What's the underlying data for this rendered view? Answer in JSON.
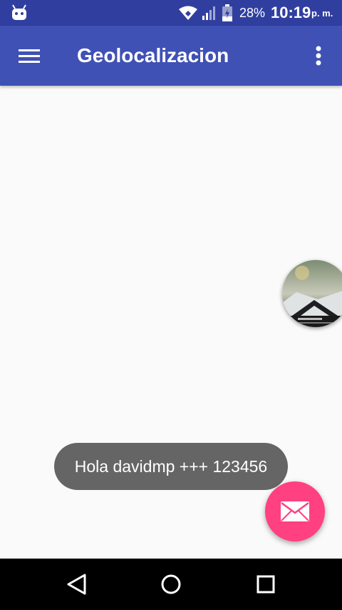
{
  "status_bar": {
    "icons": [
      "android-icon",
      "wifi-icon",
      "signal-icon",
      "battery-icon"
    ],
    "battery": "28%",
    "time": "10:19",
    "ampm": "p. m."
  },
  "app_bar": {
    "title": "Geolocalizacion",
    "menu_icon": "hamburger-menu-icon",
    "overflow_icon": "more-vert-icon",
    "color": "#3F51B5"
  },
  "toast": {
    "message": "Hola davidmp +++ 123456"
  },
  "fab": {
    "icon": "mail-icon",
    "color": "#FF4081"
  },
  "nav_bar": {
    "icons": [
      "back-icon",
      "home-icon",
      "recents-icon"
    ]
  },
  "colors": {
    "status_bar": "#303F9F",
    "background": "#FAFAFA"
  }
}
